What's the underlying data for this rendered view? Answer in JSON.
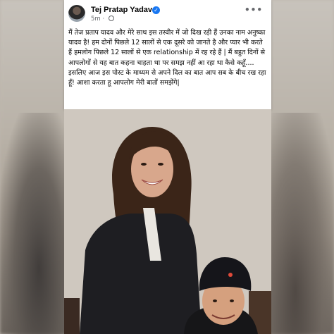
{
  "post": {
    "author": "Tej Pratap Yadav",
    "time": "5m",
    "more_label": "•••",
    "verified_glyph": "✓",
    "text": "मैं तेज प्रताप यादव और   मेरे साथ इस तस्वीर में जो दिख रही हैं उनका नाम अनुष्का यादव है! हम दोनों पिछले 12 सालों से एक दूसरे को जानते है और प्यार भी करते हैं हमलोग पिछले 12 सालों से एक relationship में रह रहे हैं | मैं बहुत दिनों से आपलोगों से यह बात कहना चाहता था पर समझ नहीं आ रहा था कैसे कहूँ.... इसलिए आज इस पोस्ट के माध्यम से अपने दिल का बात आप सब के बीच रख रहा हूँ! आशा करता हू आपलोग मेरी बातों समझेंगे|"
  },
  "colors": {
    "verified": "#1877f2",
    "card_bg": "#ffffff",
    "text": "#050505",
    "meta": "#65676b"
  },
  "icons": [
    "verified-icon",
    "globe-icon",
    "more-icon",
    "avatar"
  ]
}
